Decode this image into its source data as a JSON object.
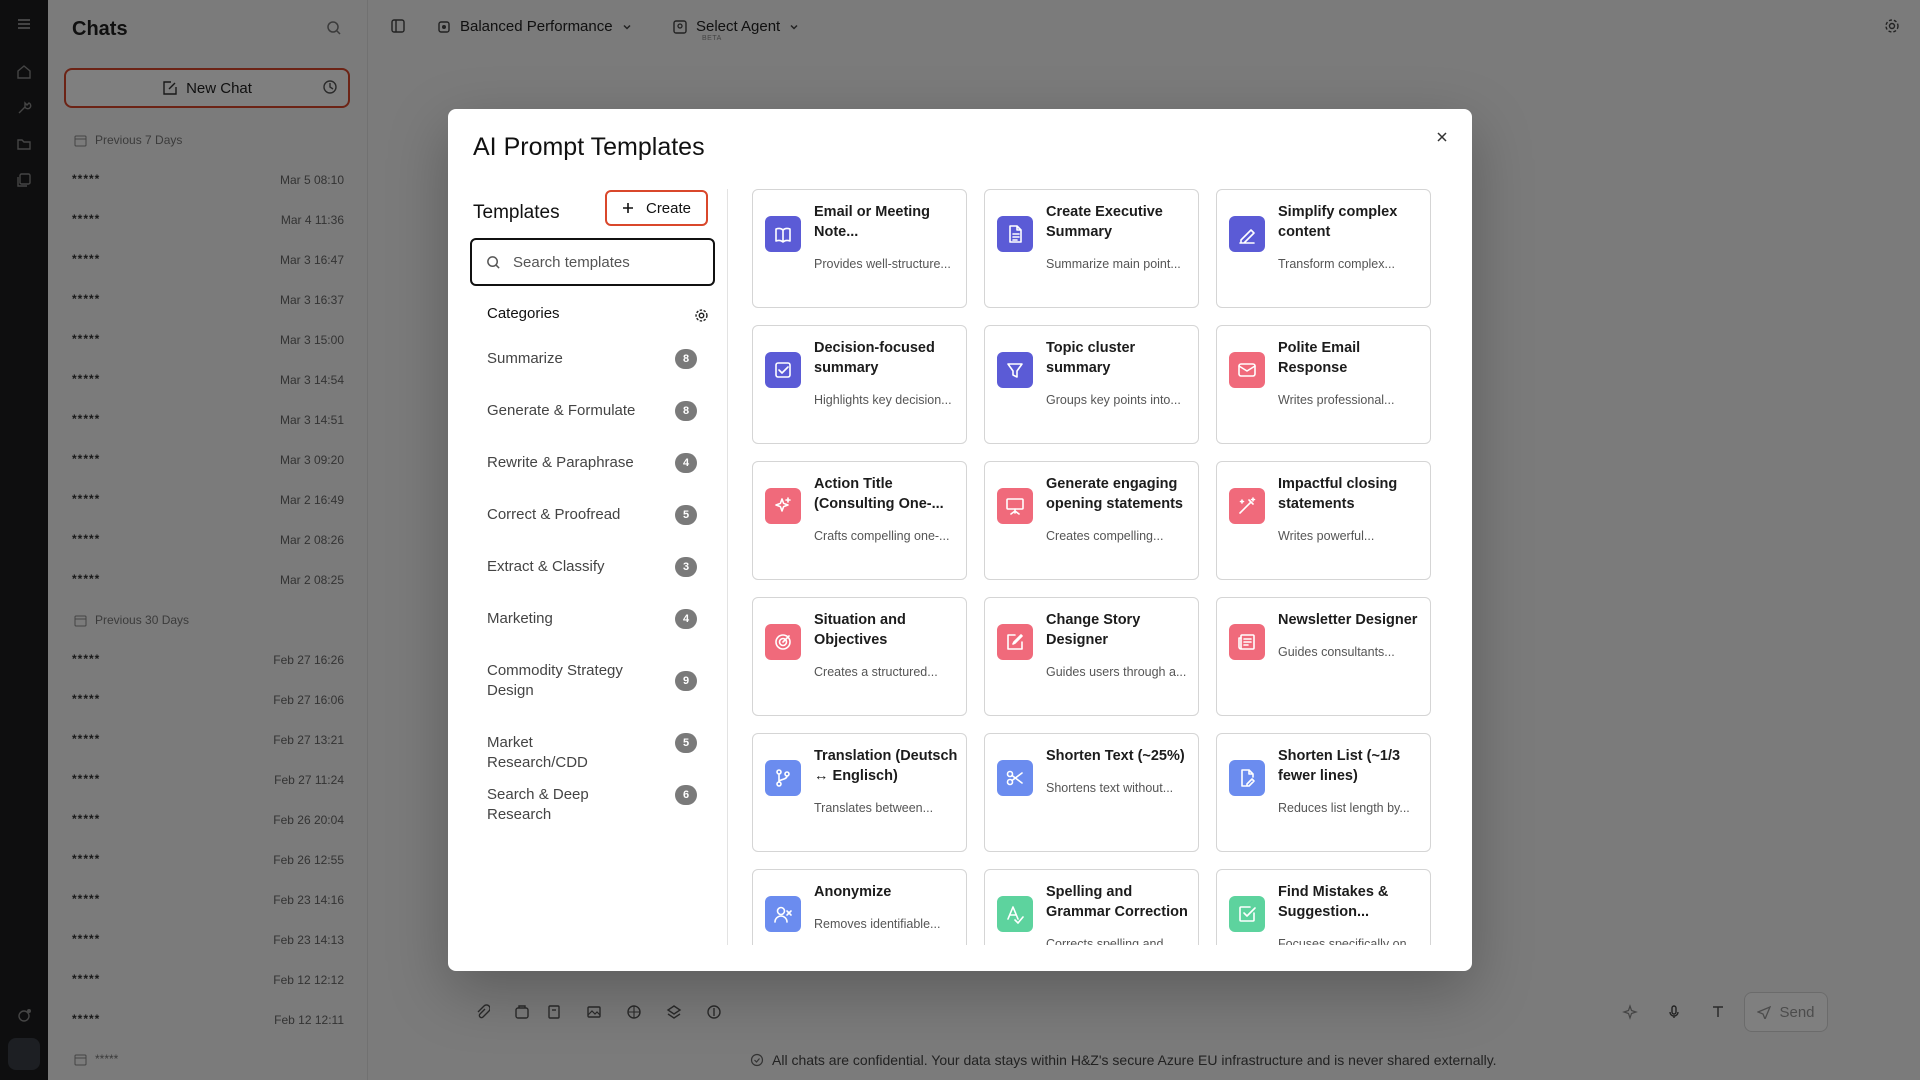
{
  "app": {
    "sidebar_title": "Chats",
    "new_chat_label": "New Chat",
    "section_7_days": "Previous 7 Days",
    "section_30_days": "Previous 30 Days",
    "chats_7": [
      {
        "name": "*****",
        "time": "Mar 5 08:10"
      },
      {
        "name": "*****",
        "time": "Mar 4 11:36"
      },
      {
        "name": "*****",
        "time": "Mar 3 16:47"
      },
      {
        "name": "*****",
        "time": "Mar 3 16:37"
      },
      {
        "name": "*****",
        "time": "Mar 3 15:00"
      },
      {
        "name": "*****",
        "time": "Mar 3 14:54"
      },
      {
        "name": "*****",
        "time": "Mar 3 14:51"
      },
      {
        "name": "*****",
        "time": "Mar 3 09:20"
      },
      {
        "name": "*****",
        "time": "Mar 2 16:49"
      },
      {
        "name": "*****",
        "time": "Mar 2 08:26"
      },
      {
        "name": "*****",
        "time": "Mar 2 08:25"
      }
    ],
    "chats_30": [
      {
        "name": "*****",
        "time": "Feb 27 16:26"
      },
      {
        "name": "*****",
        "time": "Feb 27 16:06"
      },
      {
        "name": "*****",
        "time": "Feb 27 13:21"
      },
      {
        "name": "*****",
        "time": "Feb 27 11:24"
      },
      {
        "name": "*****",
        "time": "Feb 26 20:04"
      },
      {
        "name": "*****",
        "time": "Feb 26 12:55"
      },
      {
        "name": "*****",
        "time": "Feb 23 14:16"
      },
      {
        "name": "*****",
        "time": "Feb 23 14:13"
      },
      {
        "name": "*****",
        "time": "Feb 12 12:12"
      },
      {
        "name": "*****",
        "time": "Feb 12 12:11"
      }
    ],
    "older_item": "*****",
    "model_selector": "Balanced Performance",
    "agent_selector": "Select Agent",
    "agent_badge": "BETA",
    "send_label": "Send",
    "footnote": "All chats are confidential. Your data stays within H&Z's secure Azure EU infrastructure and is never shared externally."
  },
  "modal": {
    "title": "AI Prompt Templates",
    "templates_heading": "Templates",
    "create_label": "Create",
    "search_placeholder": "Search templates",
    "categories_heading": "Categories",
    "categories": [
      {
        "label": "Summarize",
        "count": "8"
      },
      {
        "label": "Generate & Formulate",
        "count": "8"
      },
      {
        "label": "Rewrite & Paraphrase",
        "count": "4"
      },
      {
        "label": "Correct & Proofread",
        "count": "5"
      },
      {
        "label": "Extract & Classify",
        "count": "3"
      },
      {
        "label": "Marketing",
        "count": "4"
      },
      {
        "label": "Commodity Strategy Design",
        "count": "9"
      },
      {
        "label": "Market Research/CDD",
        "count": "5"
      },
      {
        "label": "Search & Deep Research",
        "count": "6"
      }
    ],
    "templates": [
      {
        "title": "Email or Meeting Note...",
        "desc": "Provides well-structure...",
        "icon": "book-open-icon",
        "color": "#5b5bd6"
      },
      {
        "title": "Create Executive Summary",
        "desc": "Summarize main point...",
        "icon": "document-icon",
        "color": "#5b5bd6"
      },
      {
        "title": "Simplify complex content",
        "desc": "Transform complex...",
        "icon": "pen-icon",
        "color": "#5b5bd6"
      },
      {
        "title": "Decision-focused summary",
        "desc": "Highlights key decision...",
        "icon": "checkbox-icon",
        "color": "#5b5bd6"
      },
      {
        "title": "Topic cluster summary",
        "desc": "Groups key points into...",
        "icon": "funnel-icon",
        "color": "#5b5bd6"
      },
      {
        "title": "Polite Email Response",
        "desc": "Writes professional...",
        "icon": "mail-icon",
        "color": "#f06a7b"
      },
      {
        "title": "Action Title (Consulting One-...",
        "desc": "Crafts compelling one-...",
        "icon": "sparkles-icon",
        "color": "#f06a7b"
      },
      {
        "title": "Generate engaging opening statements",
        "desc": "Creates compelling...",
        "icon": "presentation-icon",
        "color": "#f06a7b"
      },
      {
        "title": "Impactful closing statements",
        "desc": "Writes powerful...",
        "icon": "magic-wand-icon",
        "color": "#f06a7b"
      },
      {
        "title": "Situation and Objectives",
        "desc": "Creates a structured...",
        "icon": "target-icon",
        "color": "#f06a7b"
      },
      {
        "title": "Change Story Designer",
        "desc": "Guides users through a...",
        "icon": "edit-square-icon",
        "color": "#f06a7b"
      },
      {
        "title": "Newsletter Designer",
        "desc": "Guides consultants...",
        "icon": "newspaper-icon",
        "color": "#f06a7b"
      },
      {
        "title": "Translation (Deutsch ↔ Englisch)",
        "desc": "Translates between...",
        "icon": "git-branch-icon",
        "color": "#6b8cef"
      },
      {
        "title": "Shorten Text (~25%)",
        "desc": "Shortens text without...",
        "icon": "scissors-icon",
        "color": "#6b8cef"
      },
      {
        "title": "Shorten List (~1/3 fewer lines)",
        "desc": "Reduces list length by...",
        "icon": "file-pen-icon",
        "color": "#6b8cef"
      },
      {
        "title": "Anonymize",
        "desc": "Removes identifiable...",
        "icon": "user-x-icon",
        "color": "#6b8cef"
      },
      {
        "title": "Spelling and Grammar Correction",
        "desc": "Corrects spelling and...",
        "icon": "spellcheck-icon",
        "color": "#5dd39e"
      },
      {
        "title": "Find Mistakes & Suggestion...",
        "desc": "Focuses specifically on...",
        "icon": "check-square-icon",
        "color": "#5dd39e"
      }
    ]
  }
}
